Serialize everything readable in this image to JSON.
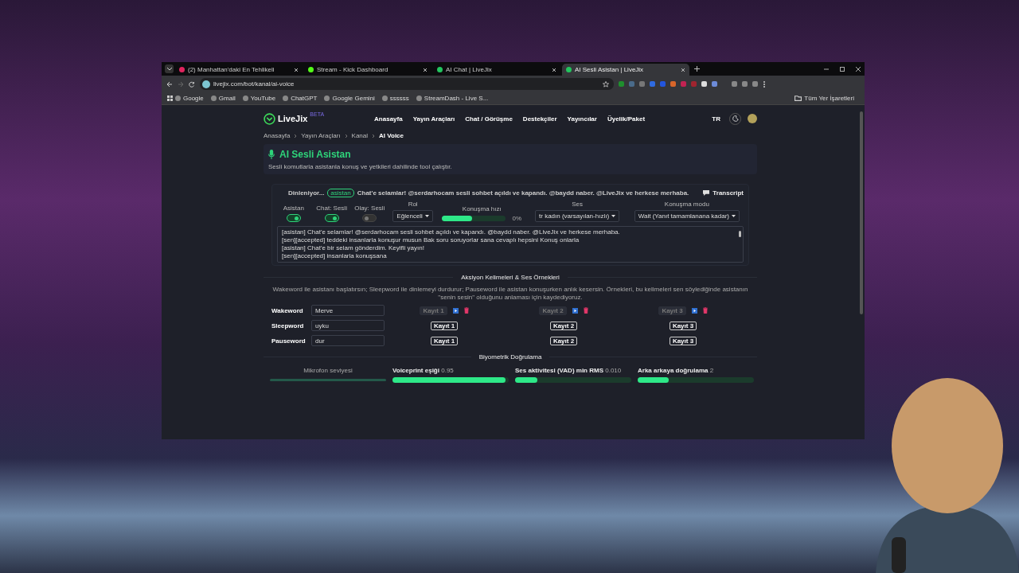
{
  "browser": {
    "tabs": [
      {
        "title": "(2) Manhattan'daki En Tehlikeli",
        "selected": false,
        "color": "#e0245e"
      },
      {
        "title": "Stream - Kick Dashboard",
        "selected": false,
        "color": "#53fc18"
      },
      {
        "title": "AI Chat | LiveJix",
        "selected": false,
        "color": "#22c55e"
      },
      {
        "title": "AI Sesli Asistan | LiveJix",
        "selected": true,
        "color": "#22c55e"
      }
    ],
    "address": "livejix.com/bot/kanal/ai-voice",
    "bookmarks": [
      "Google",
      "Gmail",
      "YouTube",
      "ChatGPT",
      "Google Gemini",
      "ssssss",
      "StreamDash - Live S..."
    ],
    "all_bookmarks": "Tüm Yer İşaretleri"
  },
  "site": {
    "logo": "LiveJix",
    "badge": "BETA",
    "nav": [
      "Anasayfa",
      "Yayın Araçları",
      "Chat / Görüşme",
      "Destekçiler",
      "Yayıncılar",
      "Üyelik/Paket"
    ],
    "language": "TR"
  },
  "breadcrumb": [
    "Anasayfa",
    "Yayın Araçları",
    "Kanal",
    "AI Voice"
  ],
  "header": {
    "title": "AI Sesli Asistan",
    "subtitle": "Sesli komutlarla asistanla konuş ve yetkileri dahilinde tool çalıştır."
  },
  "assistant": {
    "status": "Dinleniyor...",
    "speaker": "asistan",
    "message": "Chat'e selamlar! @serdarhocam sesli sohbet açıldı ve kapandı. @baydd naber. @LiveJix ve herkese merhaba.",
    "transcript_button": "Transcript",
    "toggles": [
      {
        "label": "Asistan",
        "on": true
      },
      {
        "label": "Chat: Sesli",
        "on": true
      },
      {
        "label": "Olay: Sesli",
        "on": false
      }
    ],
    "role": {
      "label": "Rol",
      "value": "Eğlenceli"
    },
    "speed": {
      "label": "Konuşma hızı",
      "level": 0.47,
      "reading": "0%"
    },
    "voice": {
      "label": "Ses",
      "value": "tr kadın (varsayılan-hızlı)"
    },
    "mode": {
      "label": "Konuşma modu",
      "value": "Wait (Yanıt tamamlanana kadar)"
    },
    "log": [
      "[asistan] Chat'e selamlar! @serdarhocam sesli sohbet açıldı ve kapandı. @baydd naber. @LiveJix ve herkese merhaba.",
      "[sen][accepted] teddeki insanlarla konuşur musun Bak soru soruyorlar sana cevaplı hepsini Konuş onlarla",
      "[asistan] Chat'e bir selam gönderdim. Keyifli yayın!",
      "[sen][accepted] insanlarla konuşsana"
    ]
  },
  "action_words": {
    "title": "Aksiyon Kelimeleri & Ses Örnekleri",
    "description": "Wakeword ile asistanı başlatırsın; Sleepword ile dinlemeyi durdurur; Pauseword ile asistan konuşurken anlık kesersin. Örnekleri, bu kelimeleri sen söylediğinde asistanın \"senin sesin\" olduğunu anlaması için kaydediyoruz.",
    "rows": [
      {
        "label": "Wakeword",
        "value": "Merve",
        "samples": [
          {
            "label": "Kayıt 1",
            "recorded": true
          },
          {
            "label": "Kayıt 2",
            "recorded": true
          },
          {
            "label": "Kayıt 3",
            "recorded": true
          }
        ]
      },
      {
        "label": "Sleepword",
        "value": "uyku",
        "samples": [
          {
            "label": "Kayıt 1",
            "recorded": false
          },
          {
            "label": "Kayıt 2",
            "recorded": false
          },
          {
            "label": "Kayıt 3",
            "recorded": false
          }
        ]
      },
      {
        "label": "Pauseword",
        "value": "dur",
        "samples": [
          {
            "label": "Kayıt 1",
            "recorded": false
          },
          {
            "label": "Kayıt 2",
            "recorded": false
          },
          {
            "label": "Kayıt 3",
            "recorded": false
          }
        ]
      }
    ]
  },
  "biometric": {
    "title": "Biyometrik Doğrulama",
    "meters": [
      {
        "kind": "meter",
        "label": "Mikrofon seviyesi",
        "level": 0
      },
      {
        "kind": "slider",
        "label": "Voiceprint eşiği",
        "reading": "0.95",
        "level": 0.97
      },
      {
        "kind": "slider",
        "label": "Ses aktivitesi (VAD) min RMS",
        "reading": "0.010",
        "level": 0.19
      },
      {
        "kind": "slider",
        "label": "Arka arkaya doğrulama",
        "reading": "2",
        "level": 0.27
      }
    ]
  }
}
